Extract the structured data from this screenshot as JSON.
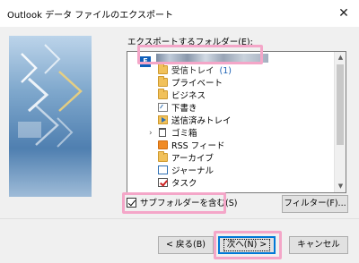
{
  "window": {
    "title": "Outlook データ ファイルのエクスポート",
    "close_label": "✕"
  },
  "folder_label": "エクスポートするフォルダー(E):",
  "tree": {
    "account_initial": "E",
    "items": [
      {
        "label": "受信トレイ",
        "count": "(1)"
      },
      {
        "label": "プライベート"
      },
      {
        "label": "ビジネス"
      },
      {
        "label": "下書き"
      },
      {
        "label": "送信済みトレイ"
      },
      {
        "label": "ゴミ箱"
      },
      {
        "label": "RSS フィード"
      },
      {
        "label": "アーカイブ"
      },
      {
        "label": "ジャーナル"
      },
      {
        "label": "タスク"
      }
    ],
    "expand_glyph": "›"
  },
  "options": {
    "include_subfolders_label": "サブフォルダーを含む(S)",
    "include_subfolders_checked": true
  },
  "buttons": {
    "filter": "フィルター(F)...",
    "back": "< 戻る(B)",
    "next": "次へ(N) >",
    "cancel": "キャンセル"
  }
}
